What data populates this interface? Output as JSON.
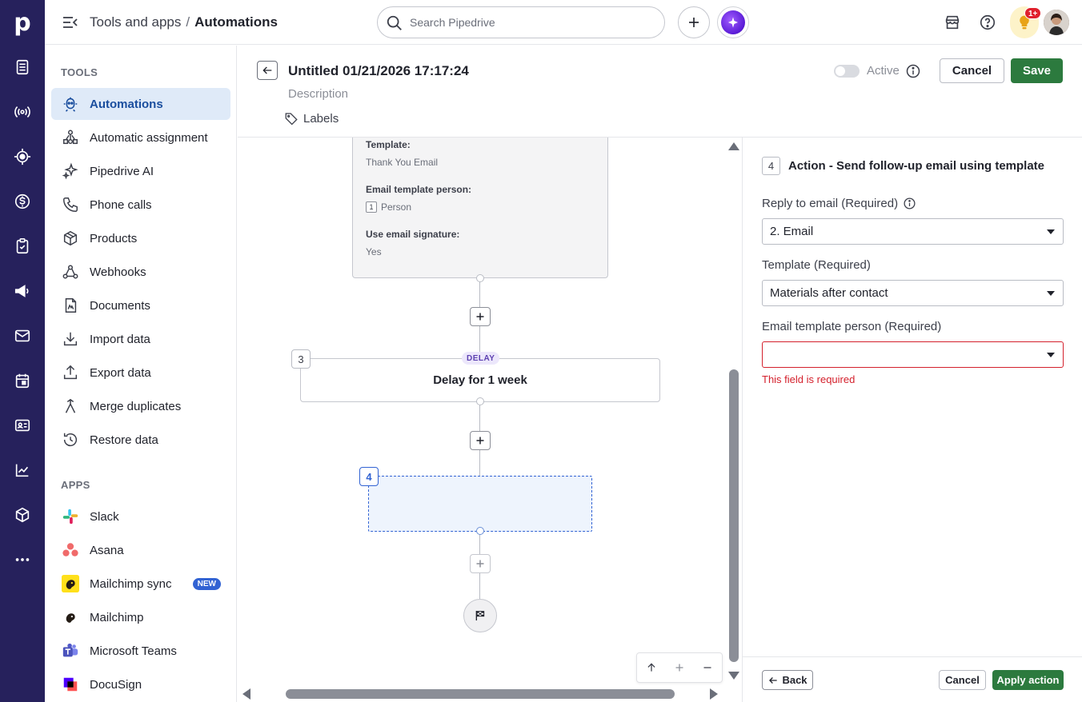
{
  "colors": {
    "rail": "#26215c",
    "accent": "#2c7a3e",
    "active_bg": "#dfeaf8",
    "error": "#d4202c",
    "brand_blue": "#3263d3"
  },
  "rail": {
    "logo": "p",
    "items": [
      "deals-icon",
      "leads-icon",
      "target-icon",
      "dollar-icon",
      "tasks-icon",
      "campaigns-icon",
      "mail-icon",
      "calendar-icon",
      "contacts-icon",
      "insights-icon",
      "products-icon",
      "more-icon"
    ]
  },
  "header": {
    "breadcrumb_parent": "Tools and apps",
    "breadcrumb_separator": "/",
    "breadcrumb_current": "Automations",
    "search_placeholder": "Search Pipedrive",
    "notification_badge": "1+"
  },
  "sidebar": {
    "tools_heading": "TOOLS",
    "tools": [
      {
        "label": "Automations",
        "icon": "automations-icon",
        "active": true
      },
      {
        "label": "Automatic assignment",
        "icon": "assignment-icon"
      },
      {
        "label": "Pipedrive AI",
        "icon": "sparkle-icon"
      },
      {
        "label": "Phone calls",
        "icon": "phone-icon"
      },
      {
        "label": "Products",
        "icon": "box-icon"
      },
      {
        "label": "Webhooks",
        "icon": "webhook-icon"
      },
      {
        "label": "Documents",
        "icon": "document-icon"
      },
      {
        "label": "Import data",
        "icon": "import-icon"
      },
      {
        "label": "Export data",
        "icon": "export-icon"
      },
      {
        "label": "Merge duplicates",
        "icon": "merge-icon"
      },
      {
        "label": "Restore data",
        "icon": "restore-icon"
      }
    ],
    "apps_heading": "APPS",
    "apps": [
      {
        "label": "Slack",
        "icon": "slack-icon"
      },
      {
        "label": "Asana",
        "icon": "asana-icon"
      },
      {
        "label": "Mailchimp sync",
        "icon": "mailchimp-icon",
        "badge": "NEW"
      },
      {
        "label": "Mailchimp",
        "icon": "mailchimp-icon"
      },
      {
        "label": "Microsoft Teams",
        "icon": "teams-icon"
      },
      {
        "label": "DocuSign",
        "icon": "docusign-icon"
      }
    ]
  },
  "automation": {
    "title": "Untitled 01/21/2026 17:17:24",
    "description_placeholder": "Description",
    "labels": "Labels",
    "status_label": "Active",
    "active": false,
    "cancel_label": "Cancel",
    "save_label": "Save"
  },
  "canvas": {
    "step2": {
      "template_key": "Template:",
      "template_value": "Thank You Email",
      "person_key": "Email template person:",
      "person_num": "1",
      "person_value": "Person",
      "signature_key": "Use email signature:",
      "signature_value": "Yes"
    },
    "step3": {
      "num": "3",
      "badge": "DELAY",
      "text": "Delay for 1 week"
    },
    "step4": {
      "num": "4"
    }
  },
  "panel": {
    "step_num": "4",
    "title": "Action - Send follow-up email using template",
    "reply_label": "Reply to email (Required)",
    "reply_value": "2. Email",
    "template_label": "Template (Required)",
    "template_value": "Materials after contact",
    "person_label": "Email template person (Required)",
    "person_value": "",
    "error": "This field is required",
    "back_label": "Back",
    "cancel_label": "Cancel",
    "apply_label": "Apply action"
  }
}
